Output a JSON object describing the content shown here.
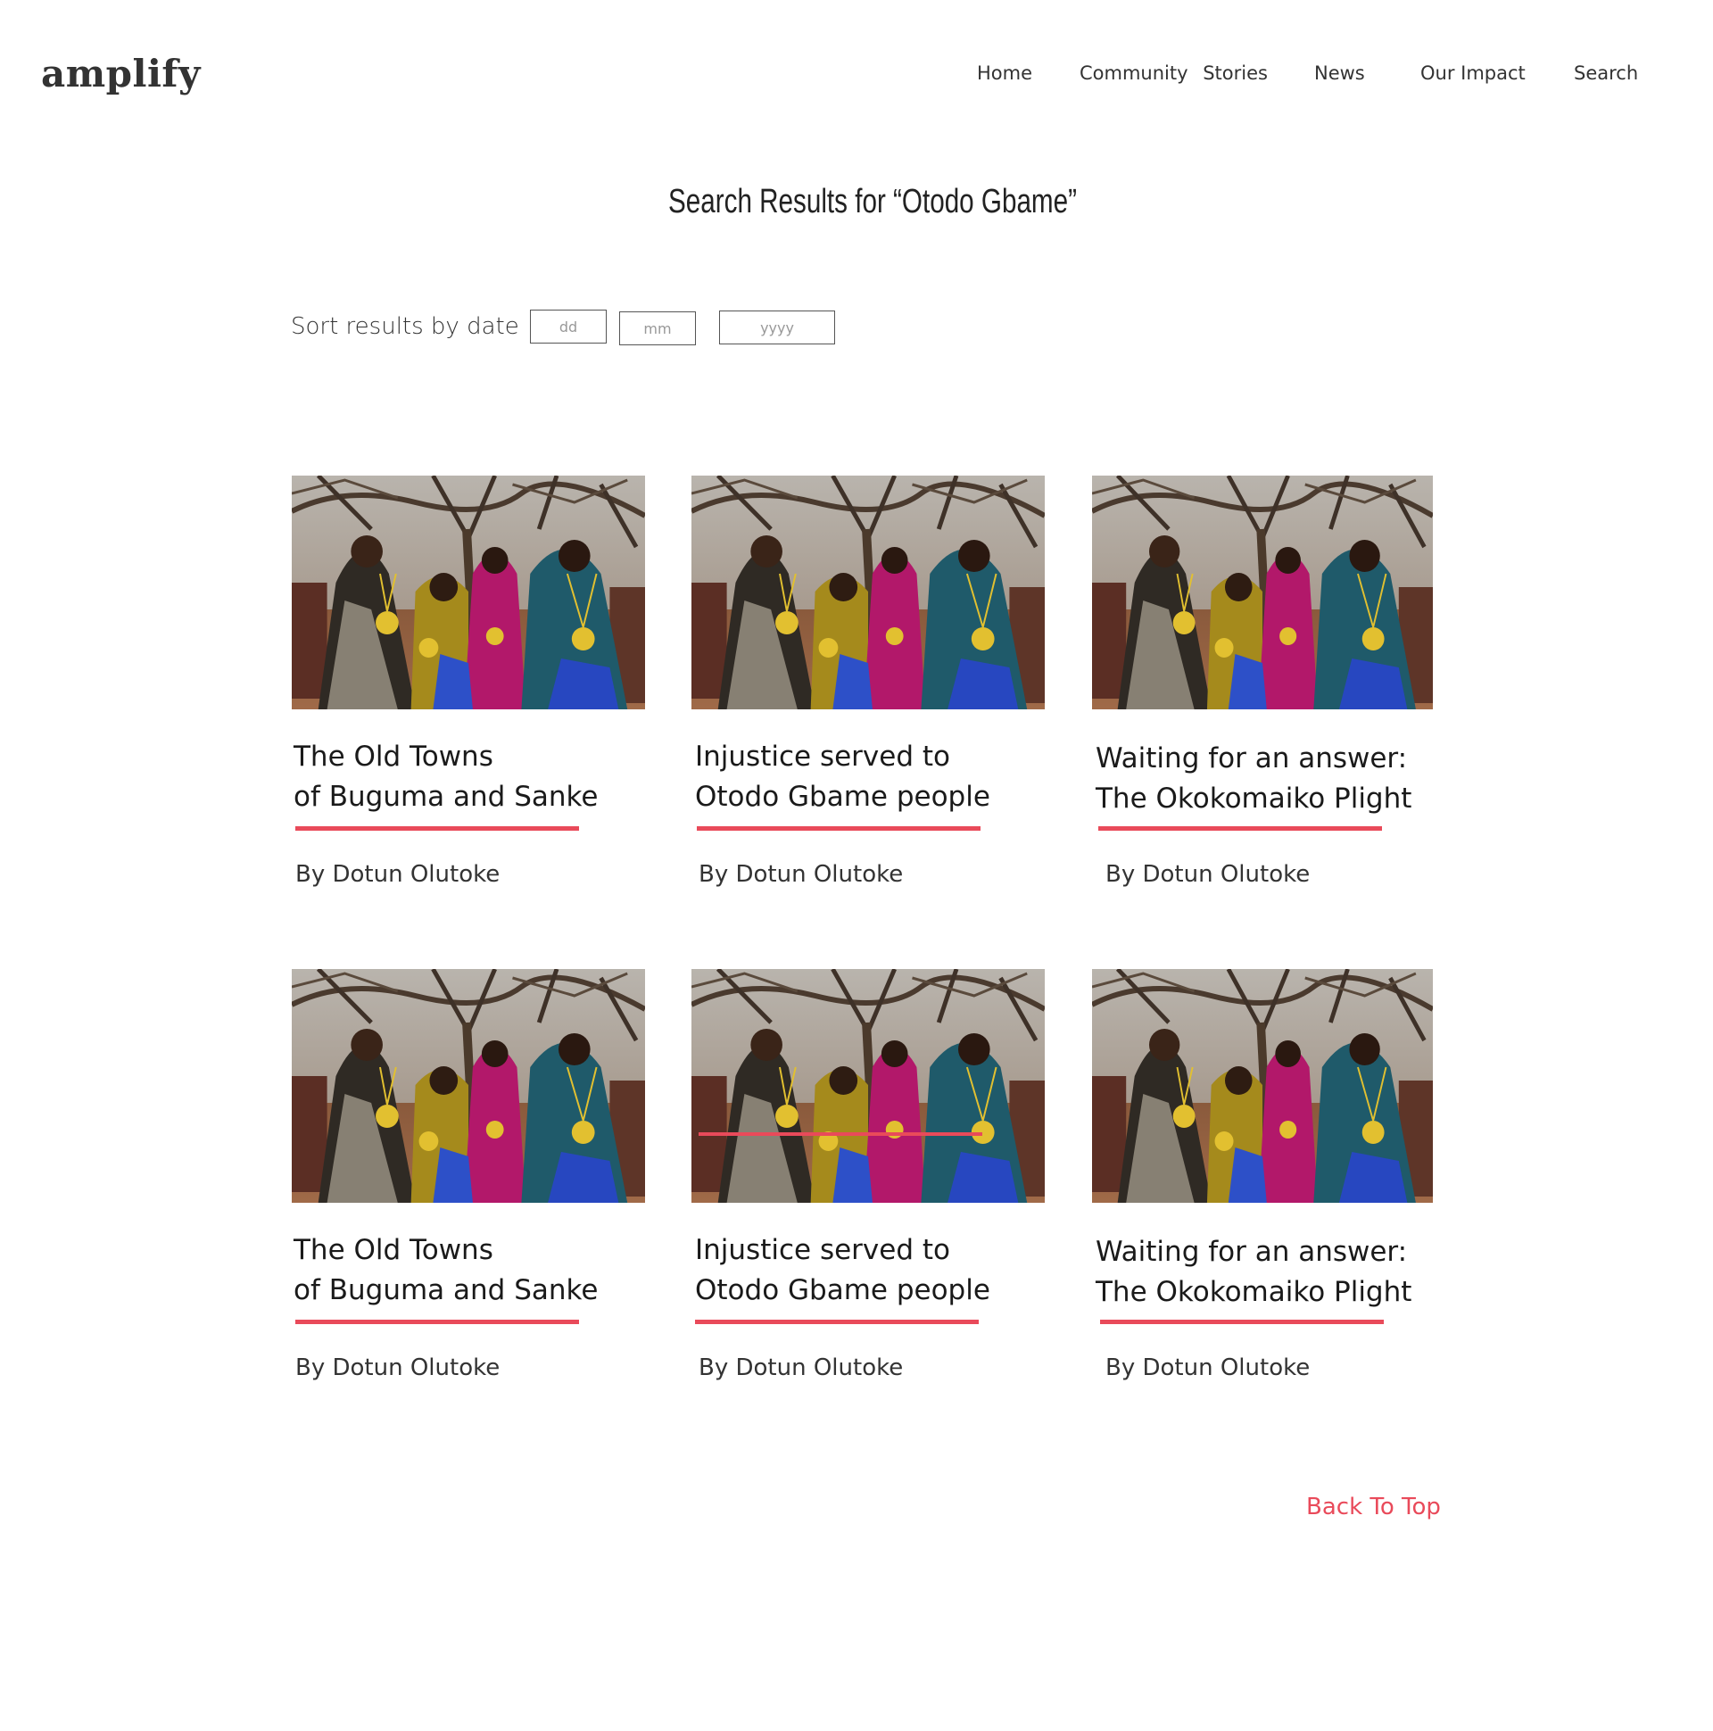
{
  "header": {
    "logo": "amplify",
    "nav": {
      "home": "Home",
      "community_stories": "Community Stories",
      "news": "News",
      "our_impact": "Our Impact",
      "search": "Search"
    }
  },
  "main": {
    "title": "Search Results for “Otodo Gbame”",
    "sort": {
      "label": "Sort results by date",
      "day_placeholder": "dd",
      "month_placeholder": "mm",
      "year_placeholder": "yyyy"
    },
    "cards": [
      {
        "title_line1": "The Old Towns",
        "title_line2": "of Buguma and Sanke",
        "author": "By Dotun Olutoke"
      },
      {
        "title_line1": "Injustice served to",
        "title_line2": "Otodo Gbame people",
        "author": "By Dotun Olutoke"
      },
      {
        "title_line1": "Waiting for an answer:",
        "title_line2": "The Okokomaiko Plight",
        "author": "By Dotun Olutoke"
      },
      {
        "title_line1": "The Old Towns",
        "title_line2": "of Buguma and Sanke",
        "author": "By Dotun Olutoke"
      },
      {
        "title_line1": "Injustice served to",
        "title_line2": "Otodo Gbame people",
        "author": "By Dotun Olutoke"
      },
      {
        "title_line1": "Waiting for an answer:",
        "title_line2": "The Okokomaiko Plight",
        "author": "By Dotun Olutoke"
      }
    ],
    "back_to_top": "Back To Top"
  },
  "colors": {
    "accent": "#e94a5a",
    "text": "#222222",
    "background": "#ffffff"
  }
}
